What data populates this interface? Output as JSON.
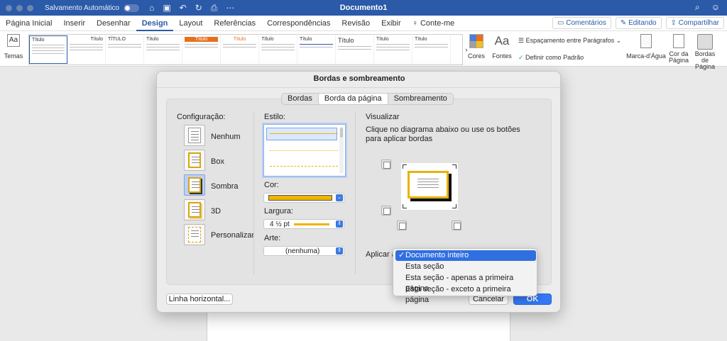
{
  "titlebar": {
    "autosave_label": "Salvamento Automático",
    "doc_title": "Documento1"
  },
  "tabs": [
    {
      "label": "Página Inicial"
    },
    {
      "label": "Inserir"
    },
    {
      "label": "Desenhar"
    },
    {
      "label": "Design"
    },
    {
      "label": "Layout"
    },
    {
      "label": "Referências"
    },
    {
      "label": "Correspondências"
    },
    {
      "label": "Revisão"
    },
    {
      "label": "Exibir"
    },
    {
      "label": "Conte-me"
    }
  ],
  "tabs_right": {
    "comments": "Comentários",
    "editing": "Editando",
    "share": "Compartilhar"
  },
  "ribbon": {
    "themes": "Temas",
    "styles": [
      "Título",
      "Título",
      "TÍTULO",
      "Título",
      "Título",
      "Título",
      "Título",
      "Título",
      "Título",
      "Título",
      "Título"
    ],
    "colors": "Cores",
    "fonts": "Fontes",
    "fonts_glyph": "Aa",
    "paragraph_spacing": "Espaçamento entre Parágrafos",
    "set_default": "Definir como Padrão",
    "watermark": "Marca-d'Água",
    "page_color": "Cor da Página",
    "page_borders": "Bordas de Página"
  },
  "dialog": {
    "title": "Bordas e sombreamento",
    "segments": [
      "Bordas",
      "Borda da página",
      "Sombreamento"
    ],
    "config_label": "Configuração:",
    "config_items": [
      "Nenhum",
      "Box",
      "Sombra",
      "3D",
      "Personalizar"
    ],
    "style_label": "Estilo:",
    "color_label": "Cor:",
    "width_label": "Largura:",
    "width_value": "4 ½ pt",
    "art_label": "Arte:",
    "art_value": "(nenhuma)",
    "preview_label": "Visualizar",
    "preview_hint": "Clique no diagrama abaixo ou use os botões para aplicar bordas",
    "apply_label": "Aplicar a",
    "horizontal_line_button": "Linha horizontal...",
    "cancel_button": "Cancelar",
    "ok_button": "OK",
    "border_color": "#f0b400"
  },
  "apply_menu": {
    "selected": "Documento inteiro",
    "items": [
      "Documento inteiro",
      "Esta seção",
      "Esta seção - apenas a primeira página",
      "Esta seção - exceto a primeira página"
    ]
  }
}
